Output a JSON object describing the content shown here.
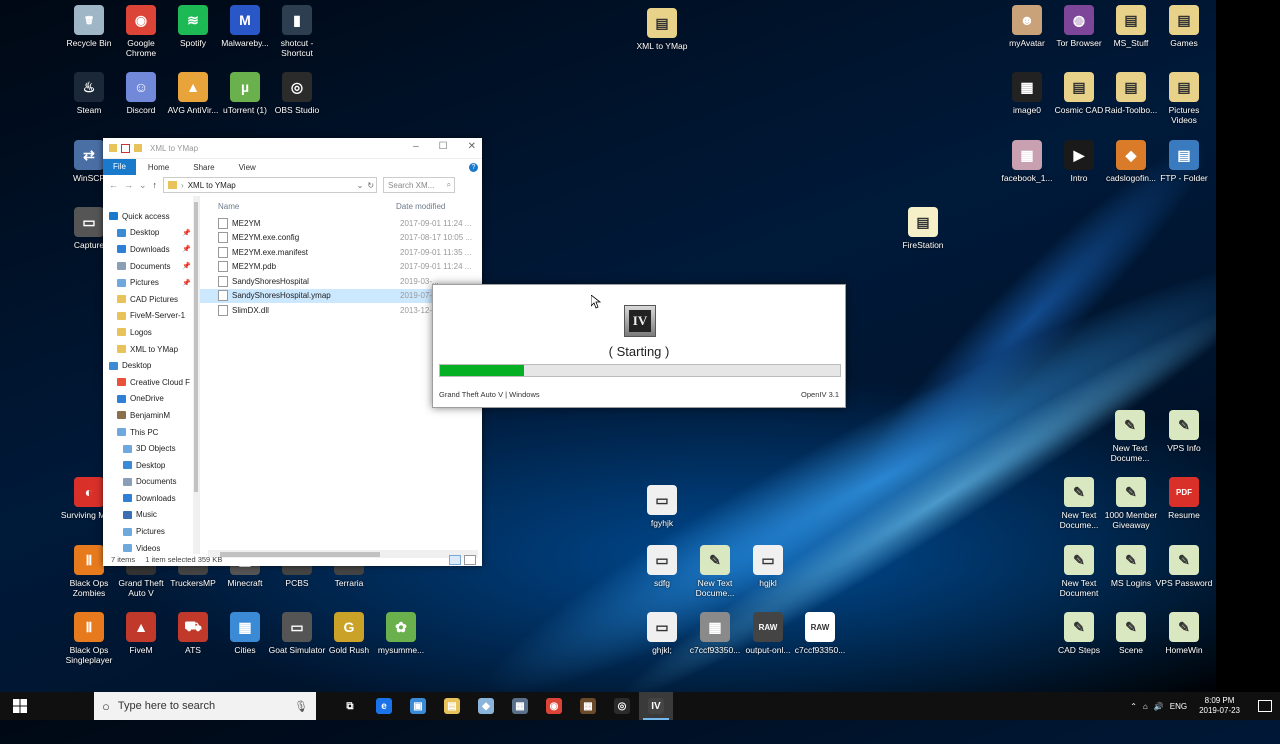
{
  "desktop_icons": [
    {
      "id": "recycle-bin",
      "label": "Recycle Bin",
      "color": "#9fb6c7",
      "glyph": "🗑"
    },
    {
      "id": "google-chrome",
      "label": "Google Chrome",
      "color": "#db4437",
      "glyph": "◉"
    },
    {
      "id": "spotify",
      "label": "Spotify",
      "color": "#1db954",
      "glyph": "≋"
    },
    {
      "id": "malwarebytes",
      "label": "Malwareby...",
      "color": "#2a57c7",
      "glyph": "M"
    },
    {
      "id": "shotcut",
      "label": "shotcut - Shortcut",
      "color": "#2c3e50",
      "glyph": "▮"
    },
    {
      "id": "steam",
      "label": "Steam",
      "color": "#1b2838",
      "glyph": "♨"
    },
    {
      "id": "discord",
      "label": "Discord",
      "color": "#7289da",
      "glyph": "☺"
    },
    {
      "id": "avg",
      "label": "AVG AntiVir...",
      "color": "#e8a33b",
      "glyph": "▲"
    },
    {
      "id": "utorrent",
      "label": "uTorrent (1)",
      "color": "#6ab04c",
      "glyph": "µ"
    },
    {
      "id": "obs",
      "label": "OBS Studio",
      "color": "#2b2b2b",
      "glyph": "◎"
    },
    {
      "id": "winscp",
      "label": "WinSCP",
      "color": "#4a6fa5",
      "glyph": "⇄"
    },
    {
      "id": "capture",
      "label": "Capture",
      "color": "#555555",
      "glyph": "▭"
    },
    {
      "id": "xml-to-ymap-desk",
      "label": "XML to YMap",
      "color": "#e8d28a",
      "glyph": "▤"
    },
    {
      "id": "myavatar",
      "label": "myAvatar",
      "color": "#c9a27a",
      "glyph": "☻"
    },
    {
      "id": "tor-browser",
      "label": "Tor Browser",
      "color": "#7d4698",
      "glyph": "◍"
    },
    {
      "id": "ms-stuff",
      "label": "MS_Stuff",
      "color": "#e8d28a",
      "glyph": "▤"
    },
    {
      "id": "games",
      "label": "Games",
      "color": "#e8d28a",
      "glyph": "▤"
    },
    {
      "id": "image0",
      "label": "image0",
      "color": "#222222",
      "glyph": "▦"
    },
    {
      "id": "cosmic-cad",
      "label": "Cosmic CAD",
      "color": "#e8d28a",
      "glyph": "▤"
    },
    {
      "id": "raid-toolbox",
      "label": "Raid-Toolbo...",
      "color": "#e8d28a",
      "glyph": "▤"
    },
    {
      "id": "pictures-videos",
      "label": "Pictures Videos",
      "color": "#e8d28a",
      "glyph": "▤"
    },
    {
      "id": "facebook",
      "label": "facebook_1...",
      "color": "#c9a0b0",
      "glyph": "▦"
    },
    {
      "id": "intro",
      "label": "Intro",
      "color": "#1a1a1a",
      "glyph": "▶"
    },
    {
      "id": "cadslogo",
      "label": "cadslogofin...",
      "color": "#d97b29",
      "glyph": "◆"
    },
    {
      "id": "ftp-folder",
      "label": "FTP - Folder",
      "color": "#3a7bbf",
      "glyph": "▤"
    },
    {
      "id": "firestation",
      "label": "FireStation",
      "color": "#f5f0c8",
      "glyph": "▤"
    },
    {
      "id": "new-text-1",
      "label": "New Text Docume...",
      "color": "#d9e8c0",
      "glyph": "✎"
    },
    {
      "id": "vps-info",
      "label": "VPS Info",
      "color": "#d9e8c0",
      "glyph": "✎"
    },
    {
      "id": "fgyhjk",
      "label": "fgyhjk",
      "color": "#f0f0f0",
      "glyph": "▭"
    },
    {
      "id": "new-text-2",
      "label": "New Text Docume...",
      "color": "#d9e8c0",
      "glyph": "✎"
    },
    {
      "id": "1000-member",
      "label": "1000 Member Giveaway",
      "color": "#d9e8c0",
      "glyph": "✎"
    },
    {
      "id": "resume",
      "label": "Resume",
      "color": "#d9302a",
      "glyph": "PDF"
    },
    {
      "id": "surviving-mars",
      "label": "Surviving Mars",
      "color": "#d9302a",
      "glyph": "◐"
    },
    {
      "id": "sdfg",
      "label": "sdfg",
      "color": "#f0f0f0",
      "glyph": "▭"
    },
    {
      "id": "new-text-3",
      "label": "New Text Docume...",
      "color": "#d9e8c0",
      "glyph": "✎"
    },
    {
      "id": "hgjkl",
      "label": "hgjkl",
      "color": "#f0f0f0",
      "glyph": "▭"
    },
    {
      "id": "new-text-doc",
      "label": "New Text Document",
      "color": "#d9e8c0",
      "glyph": "✎"
    },
    {
      "id": "ms-logins",
      "label": "MS Logins",
      "color": "#d9e8c0",
      "glyph": "✎"
    },
    {
      "id": "vps-password",
      "label": "VPS Password",
      "color": "#d9e8c0",
      "glyph": "✎"
    },
    {
      "id": "black-ops-zombies",
      "label": "Black Ops Zombies",
      "color": "#e87a1e",
      "glyph": "Ⅱ"
    },
    {
      "id": "gta-v",
      "label": "Grand Theft Auto V",
      "color": "#333333",
      "glyph": "V"
    },
    {
      "id": "truckersmp",
      "label": "TruckersMP",
      "color": "#444444",
      "glyph": "▭"
    },
    {
      "id": "minecraft",
      "label": "Minecraft",
      "color": "#555555",
      "glyph": "▦"
    },
    {
      "id": "pcbs",
      "label": "PCBS",
      "color": "#444444",
      "glyph": "▭"
    },
    {
      "id": "terraria",
      "label": "Terraria",
      "color": "#444444",
      "glyph": "▭"
    },
    {
      "id": "black-ops-single",
      "label": "Black Ops Singleplayer",
      "color": "#e87a1e",
      "glyph": "Ⅱ"
    },
    {
      "id": "fivem",
      "label": "FiveM",
      "color": "#c0392b",
      "glyph": "▲"
    },
    {
      "id": "ats",
      "label": "ATS",
      "color": "#c0392b",
      "glyph": "⛟"
    },
    {
      "id": "cities",
      "label": "Cities",
      "color": "#3a8ad6",
      "glyph": "▦"
    },
    {
      "id": "goat-simulator",
      "label": "Goat Simulator",
      "color": "#555555",
      "glyph": "▭"
    },
    {
      "id": "gold-rush",
      "label": "Gold Rush",
      "color": "#c9a227",
      "glyph": "G"
    },
    {
      "id": "mysummer",
      "label": "mysumme...",
      "color": "#6ab04c",
      "glyph": "✿"
    },
    {
      "id": "ghjkl",
      "label": "ghjkl;",
      "color": "#f0f0f0",
      "glyph": "▭"
    },
    {
      "id": "c7ccf1",
      "label": "c7ccf93350...",
      "color": "#8a8a8a",
      "glyph": "▦"
    },
    {
      "id": "output-onl",
      "label": "output-onl...",
      "color": "#444444",
      "glyph": "RAW"
    },
    {
      "id": "c7ccf2",
      "label": "c7ccf93350...",
      "color": "#ffffff",
      "glyph": "RAW"
    },
    {
      "id": "cad-steps",
      "label": "CAD Steps",
      "color": "#d9e8c0",
      "glyph": "✎"
    },
    {
      "id": "scene",
      "label": "Scene",
      "color": "#d9e8c0",
      "glyph": "✎"
    },
    {
      "id": "homewin",
      "label": "HomeWin",
      "color": "#d9e8c0",
      "glyph": "✎"
    }
  ],
  "explorer": {
    "title": "XML to YMap",
    "ribbon": {
      "file": "File",
      "home": "Home",
      "share": "Share",
      "view": "View"
    },
    "address": "XML to YMap",
    "search_placeholder": "Search XM...",
    "nav_items": [
      {
        "label": "Quick access",
        "color": "#1979ca",
        "pinned": false
      },
      {
        "label": "Desktop",
        "color": "#3a8ad6",
        "pinned": true
      },
      {
        "label": "Downloads",
        "color": "#2f7fd6",
        "pinned": true
      },
      {
        "label": "Documents",
        "color": "#8a9fb5",
        "pinned": true
      },
      {
        "label": "Pictures",
        "color": "#6fa8dc",
        "pinned": true
      },
      {
        "label": "CAD Pictures",
        "color": "#e8c25a",
        "pinned": false
      },
      {
        "label": "FiveM-Server-1",
        "color": "#e8c25a",
        "pinned": false
      },
      {
        "label": "Logos",
        "color": "#e8c25a",
        "pinned": false
      },
      {
        "label": "XML to YMap",
        "color": "#e8c25a",
        "pinned": false
      },
      {
        "label": "Desktop",
        "color": "#3a8ad6",
        "pinned": false
      },
      {
        "label": "Creative Cloud F",
        "color": "#e8523a",
        "pinned": false
      },
      {
        "label": "OneDrive",
        "color": "#2f7fd6",
        "pinned": false
      },
      {
        "label": "BenjaminM",
        "color": "#8a6f4a",
        "pinned": false
      },
      {
        "label": "This PC",
        "color": "#6fa8dc",
        "pinned": false
      },
      {
        "label": "3D Objects",
        "color": "#6fa8dc",
        "pinned": false
      },
      {
        "label": "Desktop",
        "color": "#3a8ad6",
        "pinned": false
      },
      {
        "label": "Documents",
        "color": "#8a9fb5",
        "pinned": false
      },
      {
        "label": "Downloads",
        "color": "#2f7fd6",
        "pinned": false
      },
      {
        "label": "Music",
        "color": "#3a6fb5",
        "pinned": false
      },
      {
        "label": "Pictures",
        "color": "#6fa8dc",
        "pinned": false
      },
      {
        "label": "Videos",
        "color": "#6fa8dc",
        "pinned": false
      }
    ],
    "columns": {
      "name": "Name",
      "date": "Date modified"
    },
    "files": [
      {
        "name": "ME2YM",
        "date": "2017-09-01 11:24 ..."
      },
      {
        "name": "ME2YM.exe.config",
        "date": "2017-08-17 10:05 ..."
      },
      {
        "name": "ME2YM.exe.manifest",
        "date": "2017-09-01 11:35 ..."
      },
      {
        "name": "ME2YM.pdb",
        "date": "2017-09-01 11:24 ..."
      },
      {
        "name": "SandyShoresHospital",
        "date": "2019-03-..."
      },
      {
        "name": "SandyShoresHospital.ymap",
        "date": "2019-07-..."
      },
      {
        "name": "SlimDX.dll",
        "date": "2013-12-..."
      }
    ],
    "selected_index": 5,
    "status": {
      "items": "7 items",
      "selected": "1 item selected  359 KB"
    }
  },
  "openiv": {
    "logo": "IV",
    "status": "(   Starting   )",
    "progress": 0.21,
    "progress_color": "#06b025",
    "footer_left": "Grand Theft Auto V | Windows",
    "footer_right": "OpenIV 3.1"
  },
  "taskbar": {
    "search_placeholder": "Type here to search",
    "apps": [
      {
        "id": "task-view",
        "glyph": "⧉",
        "color": "#101010"
      },
      {
        "id": "edge",
        "glyph": "e",
        "color": "#1a73e8"
      },
      {
        "id": "store",
        "glyph": "▣",
        "color": "#3a8ad6"
      },
      {
        "id": "explorer",
        "glyph": "▤",
        "color": "#e8c25a"
      },
      {
        "id": "app5",
        "glyph": "◆",
        "color": "#8ab4d9"
      },
      {
        "id": "app6",
        "glyph": "▦",
        "color": "#5a6f8a"
      },
      {
        "id": "chrome",
        "glyph": "◉",
        "color": "#db4437"
      },
      {
        "id": "minecraft",
        "glyph": "▦",
        "color": "#6b4a2a"
      },
      {
        "id": "obs",
        "glyph": "◎",
        "color": "#2b2b2b"
      },
      {
        "id": "openiv",
        "glyph": "IV",
        "color": "#444444"
      }
    ],
    "active_app": 9,
    "tray": {
      "lang": "ENG",
      "time": "8:09 PM",
      "date": "2019-07-23"
    }
  }
}
